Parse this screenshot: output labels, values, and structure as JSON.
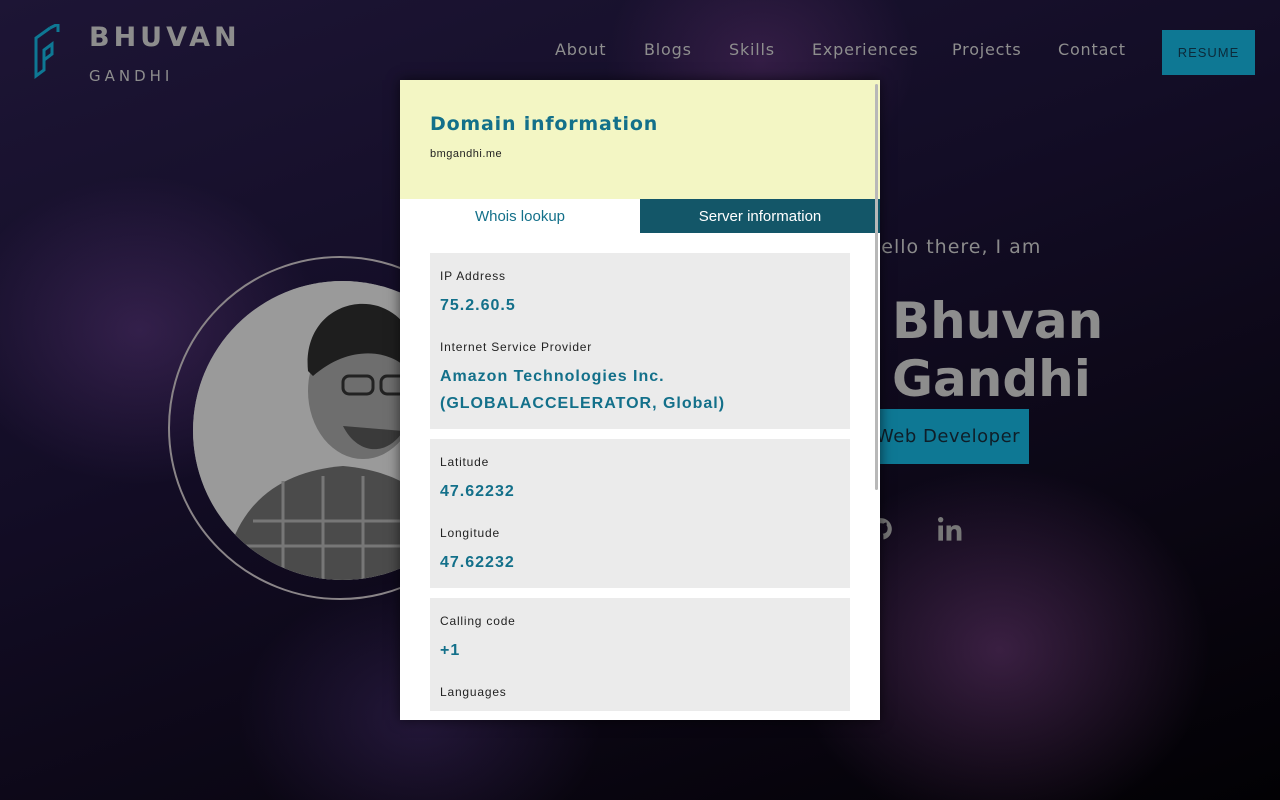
{
  "brand": {
    "first": "BHUVAN",
    "last": "GANDHI"
  },
  "nav": [
    "About",
    "Blogs",
    "Skills",
    "Experiences",
    "Projects",
    "Contact"
  ],
  "resume_label": "RESUME",
  "hero": {
    "intro": "Hello there, I am",
    "name": "Bhuvan Gandhi",
    "role": "Web Developer"
  },
  "popup": {
    "title": "Domain information",
    "domain": "bmgandhi.me",
    "tabs": {
      "whois": "Whois lookup",
      "server": "Server information"
    },
    "ip_label": "IP Address",
    "ip": "75.2.60.5",
    "isp_label": "Internet Service Provider",
    "isp": "Amazon Technologies Inc. (GLOBALACCELERATOR, Global)",
    "lat_label": "Latitude",
    "lat": "47.62232",
    "lon_label": "Longitude",
    "lon": "47.62232",
    "calling_label": "Calling code",
    "calling": "+1",
    "languages_label": "Languages"
  },
  "colors": {
    "accent": "#0e7894",
    "popup_header": "#f3f6c4",
    "active_tab": "#135668",
    "value_text": "#13708a"
  }
}
